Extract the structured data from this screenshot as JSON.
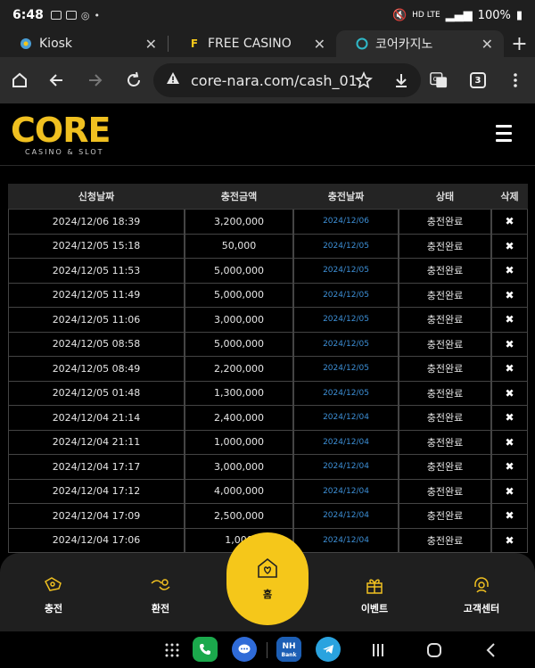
{
  "status": {
    "time": "6:48",
    "battery": "100%",
    "net": "HD LTE"
  },
  "tabs": [
    {
      "title": "Kiosk",
      "close": "✕"
    },
    {
      "title": "FREE CASINO",
      "close": "✕"
    },
    {
      "title": "코어카지노",
      "close": "✕"
    }
  ],
  "newtab": "+",
  "address": {
    "url": "core-nara.com/cash_01",
    "tab_count": "3"
  },
  "site": {
    "logo": "CORE",
    "logo_sub": "CASINO & SLOT"
  },
  "table": {
    "headers": [
      "신청날짜",
      "충전금액",
      "충전날짜",
      "상태",
      "삭제"
    ],
    "rows": [
      [
        "2024/12/06 18:39",
        "3,200,000",
        "2024/12/06",
        "충전완료",
        "✖"
      ],
      [
        "2024/12/05 15:18",
        "50,000",
        "2024/12/05",
        "충전완료",
        "✖"
      ],
      [
        "2024/12/05 11:53",
        "5,000,000",
        "2024/12/05",
        "충전완료",
        "✖"
      ],
      [
        "2024/12/05 11:49",
        "5,000,000",
        "2024/12/05",
        "충전완료",
        "✖"
      ],
      [
        "2024/12/05 11:06",
        "3,000,000",
        "2024/12/05",
        "충전완료",
        "✖"
      ],
      [
        "2024/12/05 08:58",
        "5,000,000",
        "2024/12/05",
        "충전완료",
        "✖"
      ],
      [
        "2024/12/05 08:49",
        "2,200,000",
        "2024/12/05",
        "충전완료",
        "✖"
      ],
      [
        "2024/12/05 01:48",
        "1,300,000",
        "2024/12/05",
        "충전완료",
        "✖"
      ],
      [
        "2024/12/04 21:14",
        "2,400,000",
        "2024/12/04",
        "충전완료",
        "✖"
      ],
      [
        "2024/12/04 21:11",
        "1,000,000",
        "2024/12/04",
        "충전완료",
        "✖"
      ],
      [
        "2024/12/04 17:17",
        "3,000,000",
        "2024/12/04",
        "충전완료",
        "✖"
      ],
      [
        "2024/12/04 17:12",
        "4,000,000",
        "2024/12/04",
        "충전완료",
        "✖"
      ],
      [
        "2024/12/04 17:09",
        "2,500,000",
        "2024/12/04",
        "충전완료",
        "✖"
      ],
      [
        "2024/12/04 17:06",
        "1,000",
        "2024/12/04",
        "충전완료",
        "✖"
      ]
    ]
  },
  "bottom_nav": {
    "charge": "충전",
    "exchange": "환전",
    "home": "홈",
    "event": "이벤트",
    "support": "고객센터"
  },
  "colors": {
    "accent": "#f5c71a",
    "link": "#3d8fd6"
  }
}
